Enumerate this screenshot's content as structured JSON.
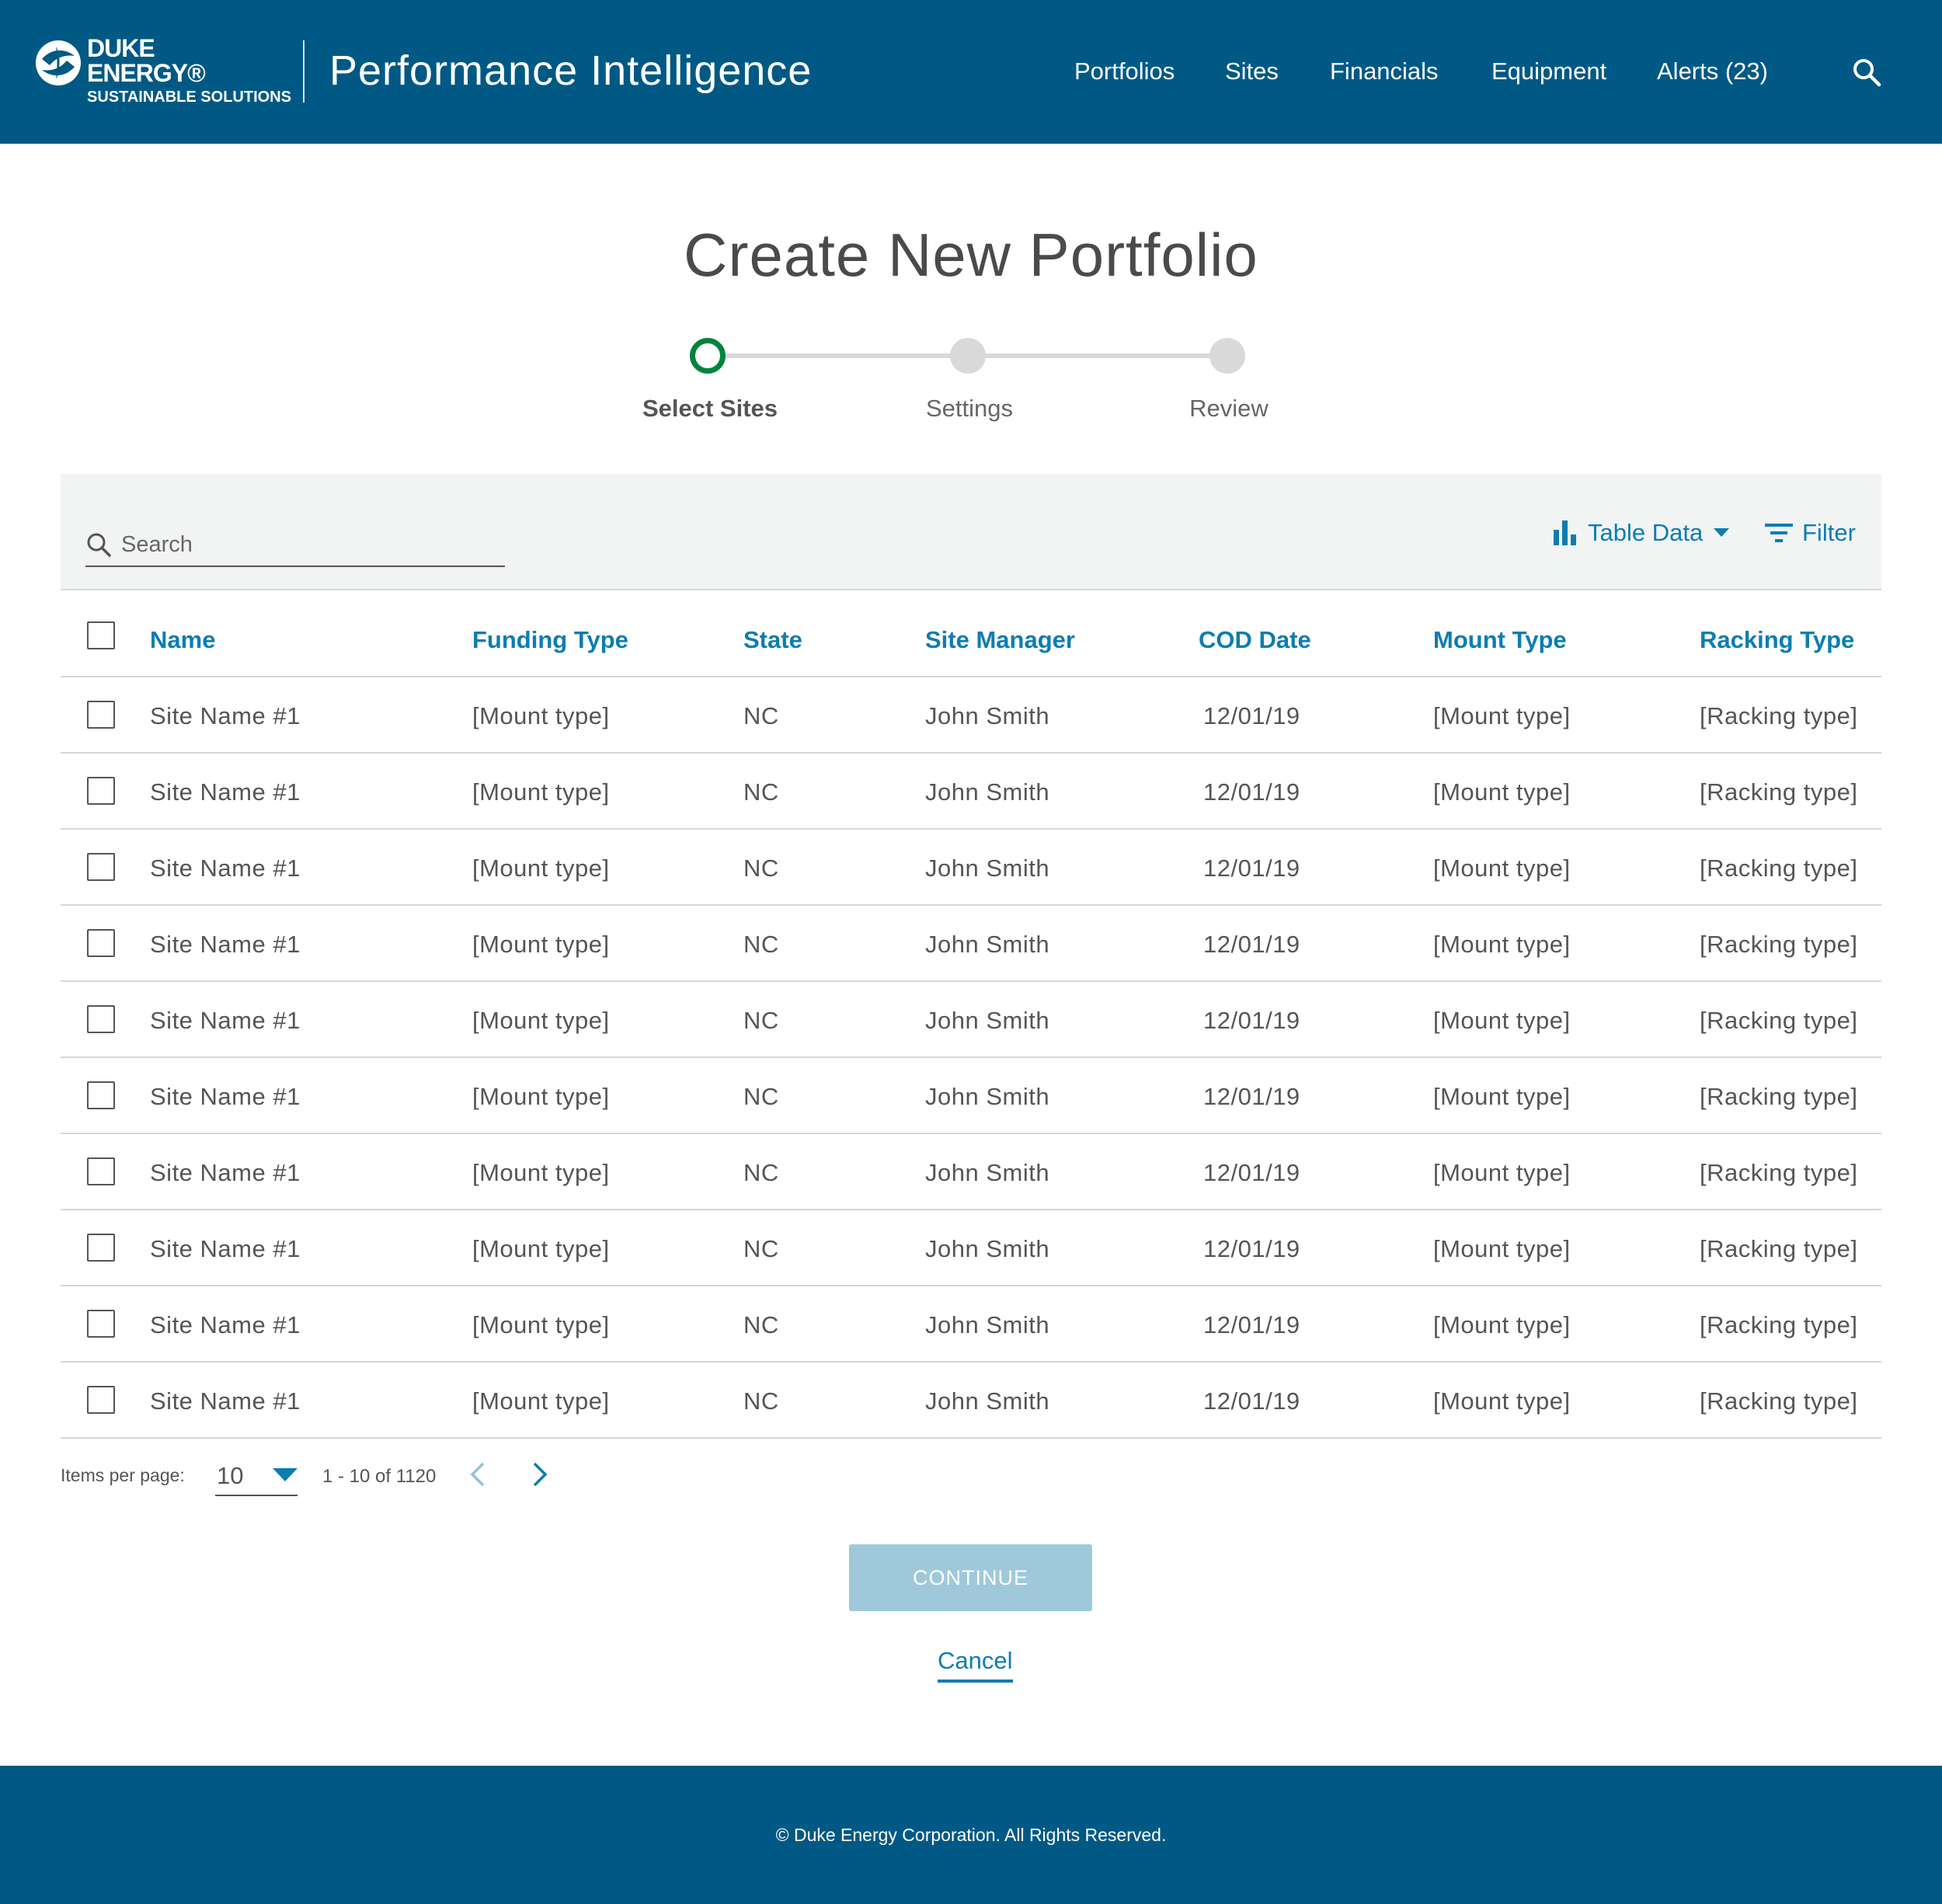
{
  "header": {
    "logo": {
      "line1": "DUKE",
      "line2": "ENERGY®",
      "line3": "SUSTAINABLE SOLUTIONS"
    },
    "app_title": "Performance Intelligence",
    "nav": [
      {
        "label": "Portfolios"
      },
      {
        "label": "Sites"
      },
      {
        "label": "Financials"
      },
      {
        "label": "Equipment"
      },
      {
        "label": "Alerts (23)"
      }
    ],
    "search_icon": "search-icon",
    "color": "#005984"
  },
  "page": {
    "title": "Create New Portfolio"
  },
  "stepper": {
    "steps": [
      {
        "label": "Select Sites",
        "state": "active"
      },
      {
        "label": "Settings",
        "state": "inactive"
      },
      {
        "label": "Review",
        "state": "inactive"
      }
    ],
    "active_color": "#00843d"
  },
  "toolbar": {
    "search_placeholder": "Search",
    "table_data_label": "Table Data",
    "filter_label": "Filter",
    "accent_color": "#0c7db1"
  },
  "table": {
    "columns": [
      "Name",
      "Funding Type",
      "State",
      "Site Manager",
      "COD Date",
      "Mount Type",
      "Racking Type"
    ],
    "rows": [
      [
        "Site Name #1",
        "[Mount type]",
        "NC",
        "John Smith",
        "12/01/19",
        "[Mount type]",
        "[Racking type]"
      ],
      [
        "Site Name #1",
        "[Mount type]",
        "NC",
        "John Smith",
        "12/01/19",
        "[Mount type]",
        "[Racking type]"
      ],
      [
        "Site Name #1",
        "[Mount type]",
        "NC",
        "John Smith",
        "12/01/19",
        "[Mount type]",
        "[Racking type]"
      ],
      [
        "Site Name #1",
        "[Mount type]",
        "NC",
        "John Smith",
        "12/01/19",
        "[Mount type]",
        "[Racking type]"
      ],
      [
        "Site Name #1",
        "[Mount type]",
        "NC",
        "John Smith",
        "12/01/19",
        "[Mount type]",
        "[Racking type]"
      ],
      [
        "Site Name #1",
        "[Mount type]",
        "NC",
        "John Smith",
        "12/01/19",
        "[Mount type]",
        "[Racking type]"
      ],
      [
        "Site Name #1",
        "[Mount type]",
        "NC",
        "John Smith",
        "12/01/19",
        "[Mount type]",
        "[Racking type]"
      ],
      [
        "Site Name #1",
        "[Mount type]",
        "NC",
        "John Smith",
        "12/01/19",
        "[Mount type]",
        "[Racking type]"
      ],
      [
        "Site Name #1",
        "[Mount type]",
        "NC",
        "John Smith",
        "12/01/19",
        "[Mount type]",
        "[Racking type]"
      ],
      [
        "Site Name #1",
        "[Mount type]",
        "NC",
        "John Smith",
        "12/01/19",
        "[Mount type]",
        "[Racking type]"
      ]
    ]
  },
  "pagination": {
    "items_per_page_label": "Items per page:",
    "items_per_page_value": "10",
    "range": "1 - 10 of 1120"
  },
  "actions": {
    "continue_label": "CONTINUE",
    "cancel_label": "Cancel",
    "continue_color": "#9fc9da"
  },
  "footer": {
    "text": "© Duke Energy Corporation. All Rights Reserved."
  }
}
